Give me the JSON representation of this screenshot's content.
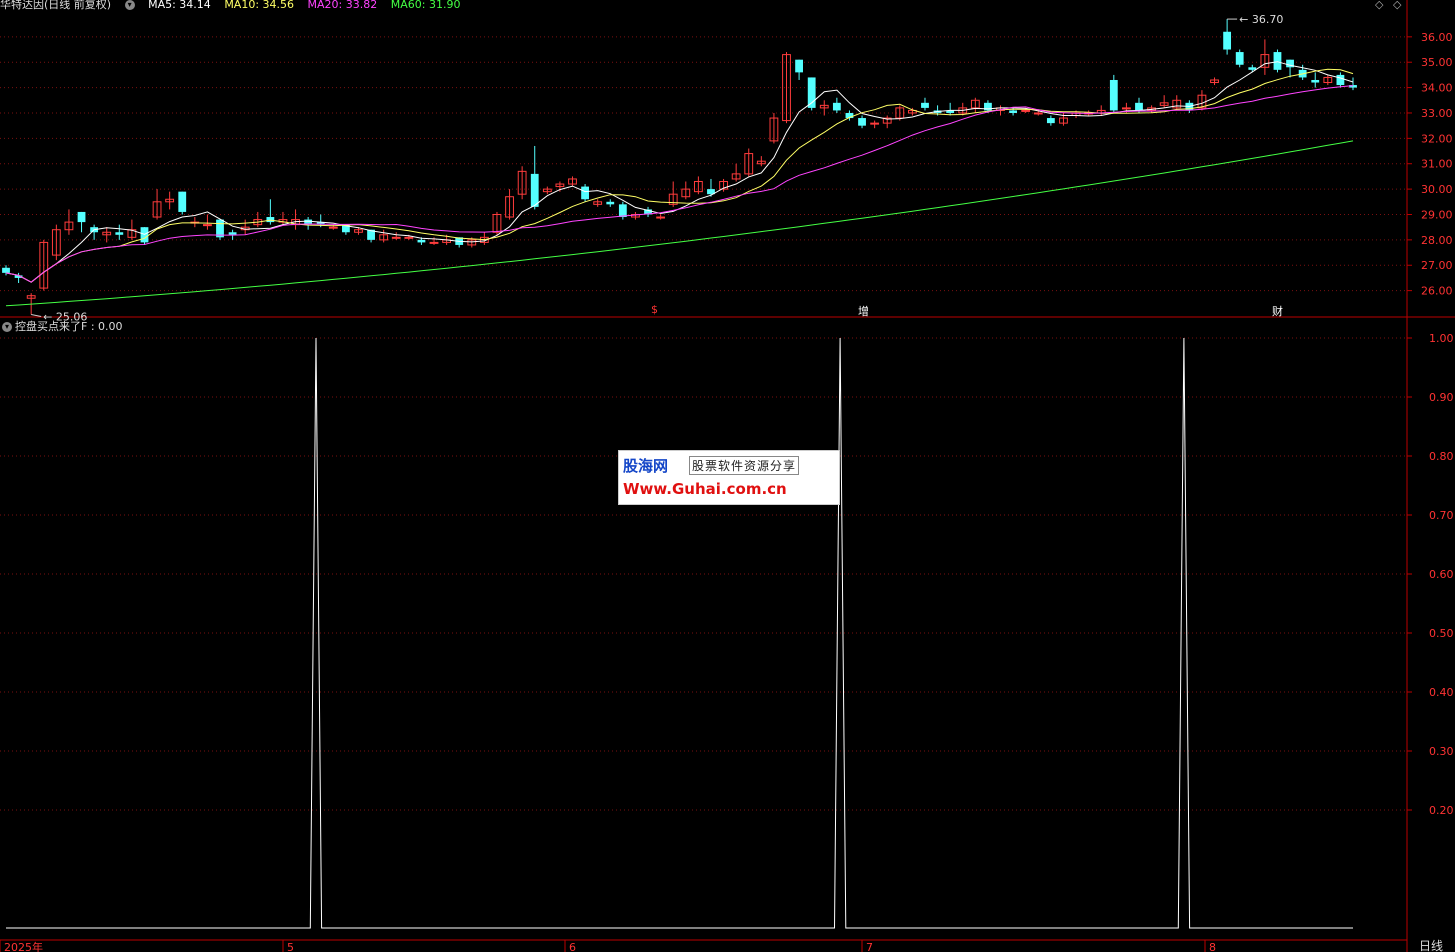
{
  "header": {
    "title": "华特达因(日线 前复权)",
    "indicators": [
      {
        "label": "MA5: 34.14",
        "color": "#ffffff"
      },
      {
        "label": "MA10: 34.56",
        "color": "#ffff66"
      },
      {
        "label": "MA20: 33.82",
        "color": "#ff44ff"
      },
      {
        "label": "MA60: 31.90",
        "color": "#44ff44"
      }
    ]
  },
  "sub_panel": {
    "title": "控盘买点来了F : 0.00"
  },
  "watermark": {
    "brand": "股海网",
    "slogan": "股票软件资源分享",
    "url": "Www.Guhai.com.cn"
  },
  "events": [
    {
      "label": "$",
      "color": "#ff3333"
    },
    {
      "label": "增",
      "color": "#ffffff"
    },
    {
      "label": "财",
      "color": "#ffffff"
    }
  ],
  "period_label": "日线",
  "chart_data": [
    {
      "type": "candlestick",
      "title": "",
      "y_ticks": [
        "36.00",
        "35.00",
        "34.00",
        "33.00",
        "32.00",
        "31.00",
        "30.00",
        "29.00",
        "28.00",
        "27.00",
        "26.00"
      ],
      "ylim": [
        25.0,
        36.9
      ],
      "annotations": [
        {
          "label": "36.70",
          "value": 36.7
        },
        {
          "label": "25.06",
          "value": 25.06
        }
      ],
      "x_labels": [
        "2025年",
        "5",
        "6",
        "7",
        "8"
      ],
      "grid": true,
      "series_names": [
        "MA5",
        "MA10",
        "MA20",
        "MA60"
      ],
      "candles": [
        [
          26.9,
          26.7,
          27.0,
          26.6
        ],
        [
          26.6,
          26.5,
          26.7,
          26.3
        ],
        [
          25.7,
          25.8,
          25.9,
          25.06
        ],
        [
          26.1,
          27.9,
          28.0,
          26.0
        ],
        [
          27.4,
          28.4,
          28.6,
          27.2
        ],
        [
          28.4,
          28.7,
          29.2,
          28.2
        ],
        [
          29.1,
          28.7,
          29.1,
          28.3
        ],
        [
          28.5,
          28.3,
          28.6,
          28.0
        ],
        [
          28.2,
          28.3,
          28.5,
          27.9
        ],
        [
          28.3,
          28.2,
          28.6,
          28.0
        ],
        [
          28.1,
          28.4,
          28.8,
          28.0
        ],
        [
          28.5,
          27.9,
          28.5,
          27.8
        ],
        [
          28.9,
          29.5,
          30.0,
          28.8
        ],
        [
          29.5,
          29.6,
          29.9,
          29.2
        ],
        [
          29.9,
          29.1,
          29.9,
          29.0
        ],
        [
          28.7,
          28.7,
          28.9,
          28.5
        ],
        [
          28.6,
          28.6,
          29.0,
          28.4
        ],
        [
          28.8,
          28.1,
          28.8,
          28.0
        ],
        [
          28.3,
          28.2,
          28.4,
          28.0
        ],
        [
          28.4,
          28.5,
          28.8,
          28.2
        ],
        [
          28.6,
          28.8,
          29.1,
          28.5
        ],
        [
          28.9,
          28.7,
          29.6,
          28.6
        ],
        [
          28.7,
          28.8,
          29.1,
          28.6
        ],
        [
          28.6,
          28.8,
          29.2,
          28.4
        ],
        [
          28.8,
          28.6,
          28.9,
          28.4
        ],
        [
          28.7,
          28.6,
          29.0,
          28.5
        ],
        [
          28.5,
          28.5,
          28.6,
          28.4
        ],
        [
          28.6,
          28.3,
          28.6,
          28.2
        ],
        [
          28.3,
          28.4,
          28.5,
          28.2
        ],
        [
          28.4,
          28.0,
          28.4,
          27.9
        ],
        [
          28.0,
          28.2,
          28.4,
          27.9
        ],
        [
          28.1,
          28.1,
          28.3,
          28.0
        ],
        [
          28.1,
          28.1,
          28.2,
          28.0
        ],
        [
          28.0,
          27.9,
          28.1,
          27.8
        ],
        [
          27.9,
          27.9,
          28.1,
          27.8
        ],
        [
          27.9,
          28.0,
          28.2,
          27.8
        ],
        [
          28.1,
          27.8,
          28.1,
          27.7
        ],
        [
          27.8,
          28.0,
          28.1,
          27.7
        ],
        [
          27.9,
          28.1,
          28.3,
          27.8
        ],
        [
          28.3,
          29.0,
          29.1,
          28.2
        ],
        [
          28.9,
          29.7,
          30.0,
          28.8
        ],
        [
          29.8,
          30.7,
          30.9,
          29.6
        ],
        [
          30.6,
          29.3,
          31.7,
          29.2
        ],
        [
          29.9,
          30.0,
          30.1,
          29.8
        ],
        [
          30.1,
          30.2,
          30.3,
          29.9
        ],
        [
          30.2,
          30.4,
          30.5,
          30.1
        ],
        [
          30.1,
          29.6,
          30.2,
          29.5
        ],
        [
          29.4,
          29.5,
          29.6,
          29.3
        ],
        [
          29.5,
          29.4,
          29.6,
          29.3
        ],
        [
          29.4,
          28.9,
          29.5,
          28.8
        ],
        [
          28.9,
          29.0,
          29.1,
          28.8
        ],
        [
          29.2,
          29.0,
          29.3,
          28.9
        ],
        [
          28.9,
          28.9,
          29.0,
          28.8
        ],
        [
          29.4,
          29.8,
          30.3,
          29.3
        ],
        [
          29.7,
          30.0,
          30.3,
          29.6
        ],
        [
          29.9,
          30.3,
          30.5,
          29.8
        ],
        [
          30.0,
          29.8,
          30.4,
          29.7
        ],
        [
          30.0,
          30.3,
          30.4,
          29.9
        ],
        [
          30.4,
          30.6,
          31.0,
          30.3
        ],
        [
          30.6,
          31.4,
          31.6,
          30.5
        ],
        [
          31.0,
          31.1,
          31.3,
          30.9
        ],
        [
          31.9,
          32.8,
          33.0,
          31.8
        ],
        [
          32.7,
          35.3,
          35.4,
          32.6
        ],
        [
          35.1,
          34.6,
          35.1,
          34.3
        ],
        [
          34.4,
          33.2,
          34.4,
          33.1
        ],
        [
          33.2,
          33.3,
          33.5,
          32.9
        ],
        [
          33.4,
          33.1,
          33.6,
          33.0
        ],
        [
          33.0,
          32.8,
          33.1,
          32.7
        ],
        [
          32.8,
          32.5,
          32.9,
          32.4
        ],
        [
          32.6,
          32.6,
          32.7,
          32.4
        ],
        [
          32.6,
          32.8,
          32.9,
          32.4
        ],
        [
          32.8,
          33.2,
          33.3,
          32.7
        ],
        [
          33.0,
          33.1,
          33.2,
          32.9
        ],
        [
          33.4,
          33.2,
          33.6,
          33.1
        ],
        [
          33.1,
          33.0,
          33.3,
          32.9
        ],
        [
          33.1,
          33.0,
          33.4,
          32.9
        ],
        [
          33.0,
          33.2,
          33.4,
          32.9
        ],
        [
          33.2,
          33.5,
          33.6,
          33.0
        ],
        [
          33.4,
          33.1,
          33.5,
          33.0
        ],
        [
          33.1,
          33.2,
          33.3,
          32.9
        ],
        [
          33.1,
          33.0,
          33.2,
          32.9
        ],
        [
          33.1,
          33.1,
          33.2,
          33.0
        ],
        [
          33.0,
          33.0,
          33.1,
          32.9
        ],
        [
          32.8,
          32.6,
          32.9,
          32.5
        ],
        [
          32.6,
          32.8,
          33.0,
          32.5
        ],
        [
          32.9,
          33.0,
          33.1,
          32.8
        ],
        [
          33.0,
          33.0,
          33.1,
          32.9
        ],
        [
          33.0,
          33.1,
          33.3,
          32.9
        ],
        [
          34.3,
          33.1,
          34.5,
          33.0
        ],
        [
          33.2,
          33.2,
          33.4,
          33.0
        ],
        [
          33.4,
          33.1,
          33.6,
          33.0
        ],
        [
          33.1,
          33.2,
          33.3,
          33.0
        ],
        [
          33.3,
          33.4,
          33.7,
          33.2
        ],
        [
          33.2,
          33.5,
          33.7,
          33.1
        ],
        [
          33.4,
          33.1,
          33.5,
          33.0
        ],
        [
          33.2,
          33.7,
          33.9,
          33.1
        ],
        [
          34.2,
          34.3,
          34.4,
          34.1
        ],
        [
          36.2,
          35.5,
          36.7,
          35.3
        ],
        [
          35.4,
          34.9,
          35.5,
          34.8
        ],
        [
          34.8,
          34.7,
          34.9,
          34.6
        ],
        [
          34.8,
          35.3,
          35.9,
          34.5
        ],
        [
          35.4,
          34.7,
          35.5,
          34.6
        ],
        [
          35.1,
          34.8,
          35.1,
          34.4
        ],
        [
          34.7,
          34.4,
          34.9,
          34.3
        ],
        [
          34.3,
          34.2,
          34.6,
          34.0
        ],
        [
          34.2,
          34.4,
          34.5,
          34.1
        ],
        [
          34.5,
          34.1,
          34.6,
          34.0
        ],
        [
          34.1,
          34.0,
          34.4,
          33.9
        ]
      ],
      "ma_legend": [
        "MA5",
        "MA10",
        "MA20",
        "MA60"
      ]
    },
    {
      "type": "line",
      "title": "",
      "series": [
        {
          "name": "控盘买点来了F",
          "values": []
        }
      ],
      "x_count": 240,
      "pulses": [
        {
          "index": 55
        },
        {
          "index": 148
        },
        {
          "index": 209
        }
      ],
      "ylim": [
        0.0,
        1.0
      ],
      "y_ticks": [
        "1.00",
        "0.90",
        "0.80",
        "0.70",
        "0.60",
        "0.50",
        "0.40",
        "0.30",
        "0.20"
      ]
    }
  ]
}
